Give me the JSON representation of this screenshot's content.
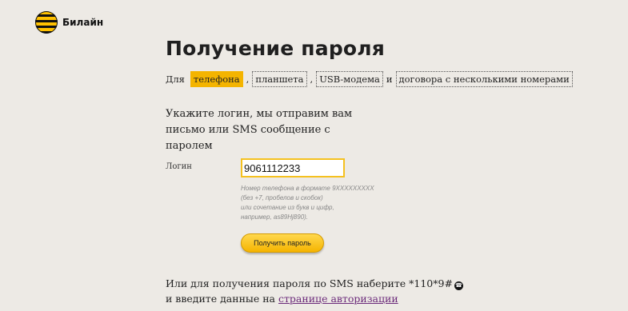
{
  "brand": {
    "name": "Билайн"
  },
  "page": {
    "title": "Получение пароля"
  },
  "device_select": {
    "lead": "Для",
    "tabs": [
      {
        "label": "телефона",
        "active": true
      },
      {
        "label": "планшета",
        "active": false
      },
      {
        "label": "USB-модема",
        "active": false
      },
      {
        "label": "договора с несколькими номерами",
        "active": false
      }
    ],
    "separators": [
      ",",
      ",",
      "и"
    ]
  },
  "instructions": {
    "line1": "Укажите логин, мы отправим вам",
    "line2": "письмо или SMS сообщение с паролем"
  },
  "login": {
    "label": "Логин",
    "value": "9061112233",
    "hint": [
      "Номер телефона в формате 9XXXXXXXXX",
      "(без +7, пробелов и скобок)",
      "или сочетание из букв и цифр,",
      "например, as89Hj890)."
    ]
  },
  "actions": {
    "get_password": "Получить пароль"
  },
  "sms_info": {
    "text1": "Или для получения пароля по SMS наберите *110*9#",
    "text2": "и введите данные на",
    "link": "странице авторизации"
  },
  "colors": {
    "accent": "#f4b400",
    "background": "#edeae5",
    "link": "#6b2a7a"
  },
  "icons": {
    "logo": "beeline-stripes-logo",
    "phone": "phone-call-icon"
  }
}
